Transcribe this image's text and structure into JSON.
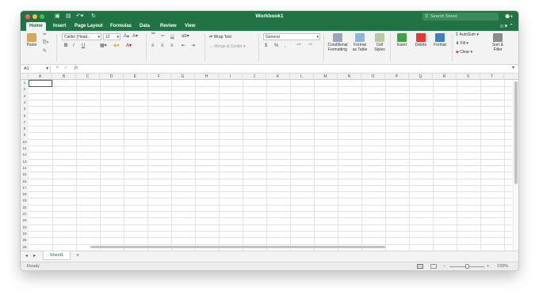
{
  "window": {
    "title": "Workbook1",
    "search_placeholder": "Search Sheet"
  },
  "quick_access": {
    "icons": [
      "sidebar-icon",
      "save-icon",
      "undo-icon",
      "redo-icon"
    ]
  },
  "tabs": [
    "Home",
    "Insert",
    "Page Layout",
    "Formulas",
    "Data",
    "Review",
    "View"
  ],
  "active_tab": "Home",
  "ribbon": {
    "paste_label": "Paste",
    "font_name": "Calibri (Head...",
    "font_size": "12",
    "wrap_text": "Wrap Text",
    "merge_center": "Merge & Center",
    "number_format": "General",
    "currency_symbol": "$",
    "percent_symbol": "%",
    "comma_symbol": ",",
    "bold": "B",
    "italic": "I",
    "underline": "U",
    "conditional_formatting_1": "Conditional",
    "conditional_formatting_2": "Formatting",
    "format_table_1": "Format",
    "format_table_2": "as Table",
    "cell_styles_1": "Cell",
    "cell_styles_2": "Styles",
    "insert": "Insert",
    "delete": "Delete",
    "format": "Format",
    "autosum": "AutoSum",
    "fill": "Fill",
    "clear": "Clear",
    "sort_filter_1": "Sort &",
    "sort_filter_2": "Filter"
  },
  "formula_bar": {
    "name_box": "A1",
    "fx": "fx",
    "value": ""
  },
  "columns": [
    "A",
    "B",
    "C",
    "D",
    "E",
    "F",
    "G",
    "H",
    "I",
    "J",
    "K",
    "L",
    "M",
    "N",
    "O",
    "P",
    "Q",
    "R",
    "S",
    "T"
  ],
  "rows": [
    "1",
    "2",
    "3",
    "4",
    "5",
    "6",
    "7",
    "8",
    "9",
    "10",
    "11",
    "12",
    "13",
    "14",
    "15",
    "16",
    "17",
    "18",
    "19",
    "20",
    "21",
    "22",
    "23",
    "24",
    "25",
    "26"
  ],
  "selected_cell": "A1",
  "sheet_tabs": [
    "Sheet1"
  ],
  "add_sheet": "+",
  "status": {
    "text": "Ready",
    "zoom": "100%",
    "zoom_minus": "−",
    "zoom_plus": "+"
  },
  "colors": {
    "accent": "#217346",
    "close": "#fc605c",
    "minimize": "#fdbc40",
    "maximize": "#34c84a"
  }
}
